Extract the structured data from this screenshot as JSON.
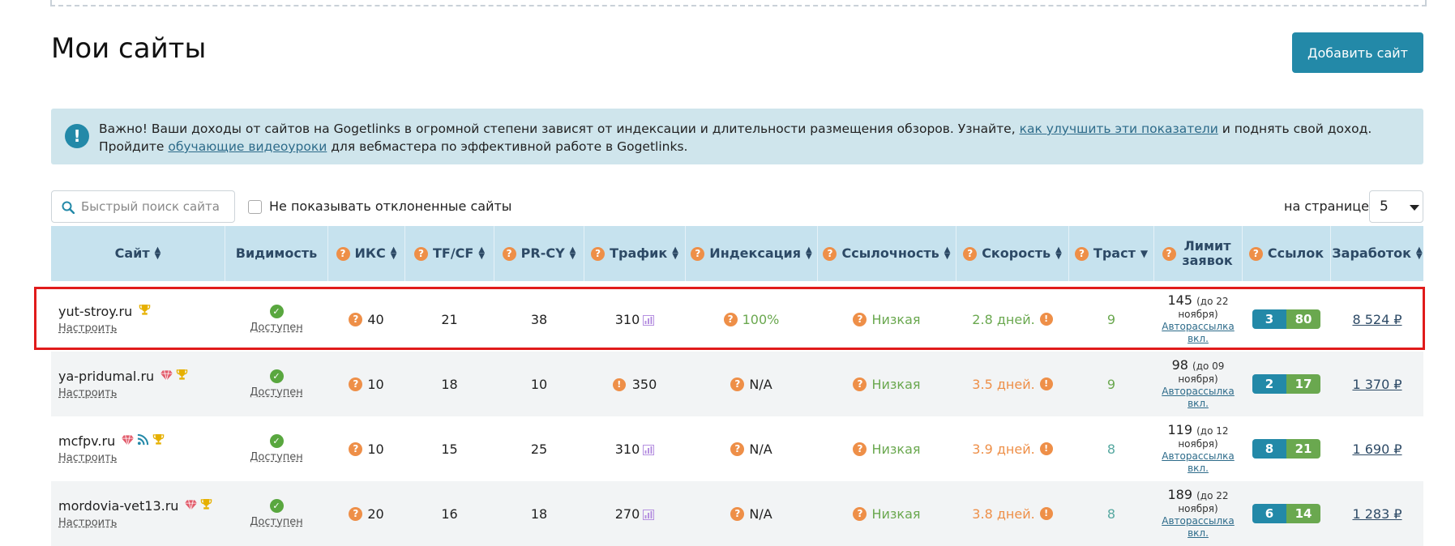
{
  "page": {
    "title": "Мои сайты",
    "add_button": "Добавить сайт"
  },
  "notice": {
    "text1": "Важно! Ваши доходы от сайтов на Gogetlinks в огромной степени зависят от индексации и длительности размещения обзоров. Узнайте, ",
    "link1": "как улучшить эти показатели",
    "text2": " и поднять свой доход. Пройдите ",
    "link2": "обучающие видеоуроки",
    "text3": " для вебмастера по эффективной работе в Gogetlinks."
  },
  "controls": {
    "search_placeholder": "Быстрый поиск сайта",
    "hide_rejected_label": "Не показывать отклоненные сайты",
    "per_page_label": "на странице",
    "per_page_value": "5"
  },
  "columns": {
    "site": "Сайт",
    "visibility": "Видимость",
    "iks": "ИКС",
    "tfcf": "TF/CF",
    "prcy": "PR-CY",
    "traffic": "Трафик",
    "indexation": "Индексация",
    "linkiness": "Ссылочность",
    "speed": "Скорость",
    "trust": "Траст",
    "limit": "Лимит заявок",
    "links": "Ссылок",
    "earned": "Заработок"
  },
  "colors": {
    "accent": "#2389a8",
    "green": "#6aa84f",
    "orange": "#ee8f48",
    "header_bg": "#c6e2ee",
    "highlight": "#e01b1b"
  },
  "rows": [
    {
      "site": "yut-stroy.ru",
      "icons": [
        "trophy-icon"
      ],
      "setup": "Настроить",
      "visibility": "Доступен",
      "iks": "40",
      "tfcf": "21",
      "prcy": "38",
      "traffic": "310",
      "traffic_warn": false,
      "indexation": "100%",
      "linkiness": "Низкая",
      "speed": "2.8 дней.",
      "trust": "9",
      "limit_num": "145",
      "limit_until_a": "(до 22",
      "limit_until_b": "ноября)",
      "autosend_a": "Авторассылка",
      "autosend_b": "вкл.",
      "links_a": "3",
      "links_b": "80",
      "earned": "8 524 ₽"
    },
    {
      "site": "ya-pridumal.ru",
      "icons": [
        "gem-icon",
        "trophy-icon"
      ],
      "setup": "Настроить",
      "visibility": "Доступен",
      "iks": "10",
      "tfcf": "18",
      "prcy": "10",
      "traffic": "350",
      "traffic_warn": true,
      "indexation": "N/A",
      "linkiness": "Низкая",
      "speed": "3.5 дней.",
      "trust": "9",
      "limit_num": "98",
      "limit_until_a": "(до 09",
      "limit_until_b": "ноября)",
      "autosend_a": "Авторассылка",
      "autosend_b": "вкл.",
      "links_a": "2",
      "links_b": "17",
      "earned": "1 370 ₽"
    },
    {
      "site": "mcfpv.ru",
      "icons": [
        "gem-icon",
        "rss-icon",
        "trophy-icon"
      ],
      "setup": "Настроить",
      "visibility": "Доступен",
      "iks": "10",
      "tfcf": "15",
      "prcy": "25",
      "traffic": "310",
      "traffic_warn": false,
      "indexation": "N/A",
      "linkiness": "Низкая",
      "speed": "3.9 дней.",
      "trust": "8",
      "limit_num": "119",
      "limit_until_a": "(до 12",
      "limit_until_b": "ноября)",
      "autosend_a": "Авторассылка",
      "autosend_b": "вкл.",
      "links_a": "8",
      "links_b": "21",
      "earned": "1 690 ₽"
    },
    {
      "site": "mordovia-vet13.ru",
      "icons": [
        "gem-icon",
        "trophy-icon"
      ],
      "setup": "Настроить",
      "visibility": "Доступен",
      "iks": "20",
      "tfcf": "16",
      "prcy": "18",
      "traffic": "270",
      "traffic_warn": false,
      "indexation": "N/A",
      "linkiness": "Низкая",
      "speed": "3.8 дней.",
      "trust": "8",
      "limit_num": "189",
      "limit_until_a": "(до 22",
      "limit_until_b": "ноября)",
      "autosend_a": "Авторассылка",
      "autosend_b": "вкл.",
      "links_a": "6",
      "links_b": "14",
      "earned": "1 283 ₽"
    }
  ]
}
